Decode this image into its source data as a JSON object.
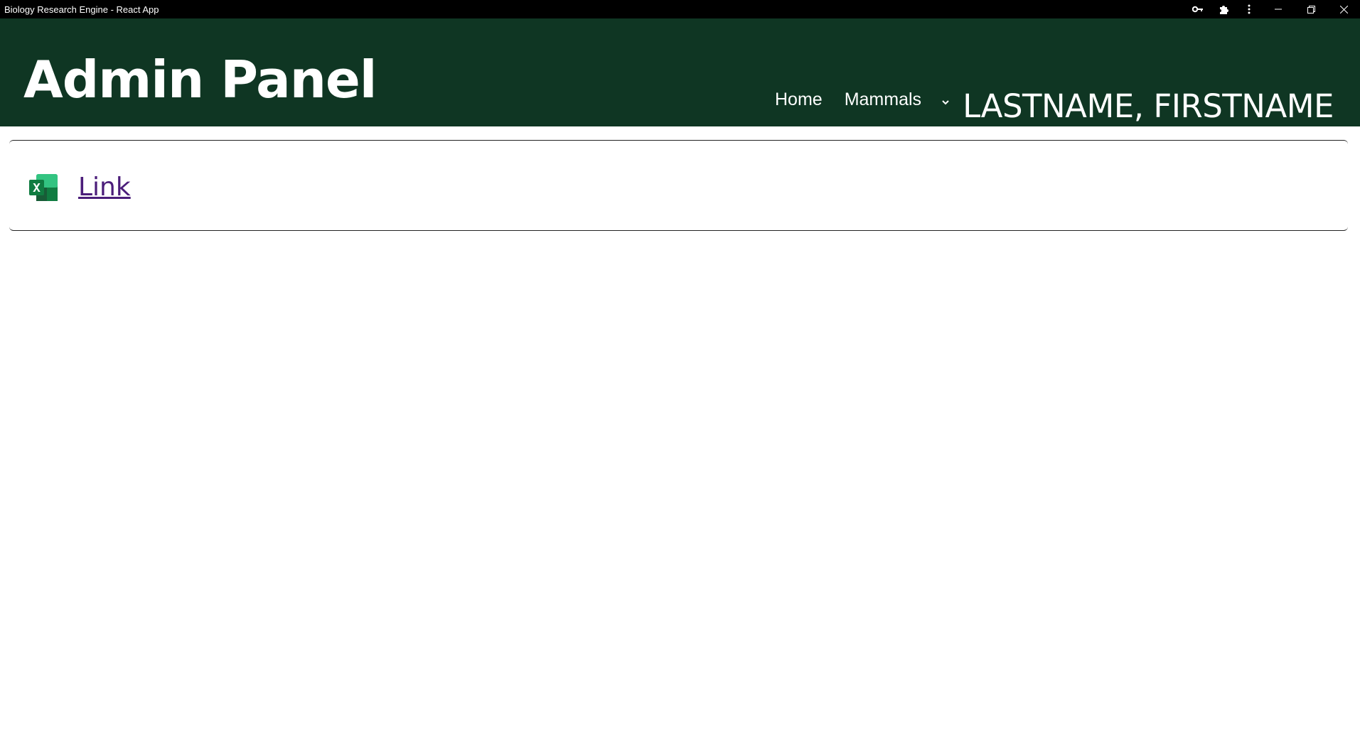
{
  "window": {
    "title": "Biology Research Engine - React App",
    "icons": [
      "key-icon",
      "extensions-icon",
      "more-vert-icon"
    ],
    "controls": [
      "minimize-icon",
      "restore-icon",
      "close-icon"
    ]
  },
  "header": {
    "brand": "Admin Panel",
    "nav": {
      "home_label": "Home",
      "mammals_label": "Mammals"
    },
    "user_name": "LASTNAME, FIRSTNAME",
    "background_color": "#0f3623"
  },
  "main": {
    "file_icon": "excel-icon",
    "link_label": "Link",
    "link_color": "#4b1d7a"
  }
}
